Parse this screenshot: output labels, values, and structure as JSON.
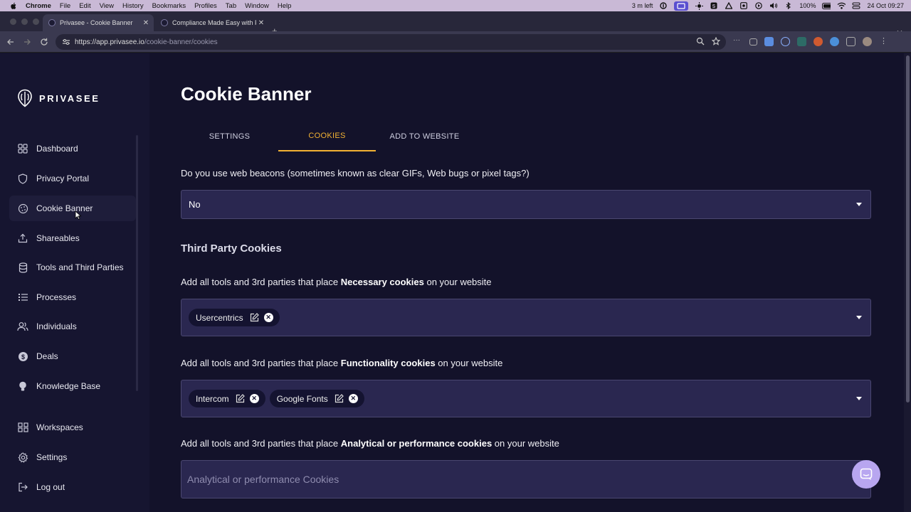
{
  "menubar": {
    "app_name": "Chrome",
    "items": [
      "File",
      "Edit",
      "View",
      "History",
      "Bookmarks",
      "Profiles",
      "Tab",
      "Window",
      "Help"
    ],
    "battery_time": "3 m left",
    "battery_pct": "100%",
    "datetime": "24 Oct  09:27"
  },
  "browser": {
    "tabs": [
      {
        "title": "Privasee - Cookie Banner",
        "active": true
      },
      {
        "title": "Compliance Made Easy with P",
        "active": false
      }
    ],
    "url_host": "https://app.privasee.io",
    "url_path": "/cookie-banner/cookies"
  },
  "sidebar": {
    "brand": "PRIVASEE",
    "items": [
      {
        "label": "Dashboard",
        "icon": "grid-icon"
      },
      {
        "label": "Privacy Portal",
        "icon": "shield-icon"
      },
      {
        "label": "Cookie Banner",
        "icon": "cookie-icon",
        "active": true
      },
      {
        "label": "Shareables",
        "icon": "upload-icon"
      },
      {
        "label": "Tools and Third Parties",
        "icon": "database-icon"
      },
      {
        "label": "Processes",
        "icon": "list-icon"
      },
      {
        "label": "Individuals",
        "icon": "users-icon"
      },
      {
        "label": "Deals",
        "icon": "dollar-icon"
      },
      {
        "label": "Knowledge Base",
        "icon": "lightbulb-icon"
      }
    ],
    "bottom_items": [
      {
        "label": "Workspaces",
        "icon": "workspaces-icon"
      },
      {
        "label": "Settings",
        "icon": "gear-icon"
      },
      {
        "label": "Log out",
        "icon": "logout-icon"
      }
    ]
  },
  "main": {
    "title": "Cookie Banner",
    "tabs": [
      {
        "label": "SETTINGS"
      },
      {
        "label": "COOKIES",
        "active": true
      },
      {
        "label": "ADD TO WEBSITE"
      }
    ],
    "beacons_question": "Do you use web beacons (sometimes known as clear GIFs, Web bugs or pixel tags?)",
    "beacons_value": "No",
    "third_party_heading": "Third Party Cookies",
    "necessary": {
      "prefix": "Add all tools and 3rd parties that place ",
      "bold": "Necessary cookies",
      "suffix": " on your website",
      "chips": [
        "Usercentrics"
      ]
    },
    "functionality": {
      "prefix": "Add all tools and 3rd parties that place ",
      "bold": "Functionality cookies",
      "suffix": " on your website",
      "chips": [
        "Intercom",
        "Google Fonts"
      ]
    },
    "analytical": {
      "prefix": "Add all tools and 3rd parties that place ",
      "bold": "Analytical or performance cookies",
      "suffix": " on your website",
      "placeholder": "Analytical or performance Cookies"
    }
  },
  "colors": {
    "accent": "#f2b233",
    "background": "#13122a",
    "sidebar": "#161530",
    "field": "#2a2750"
  }
}
